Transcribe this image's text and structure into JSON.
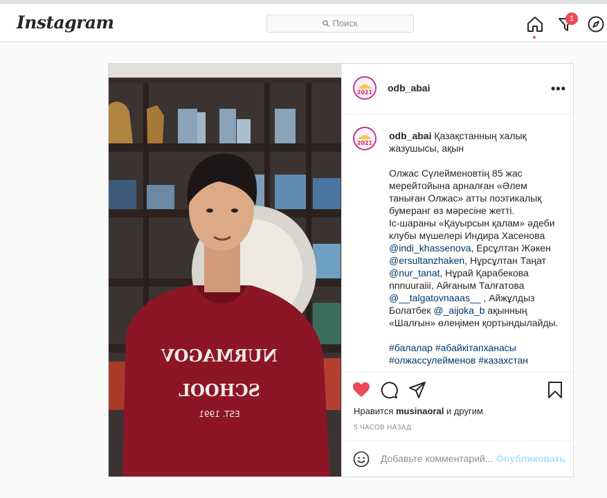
{
  "app": {
    "logo": "Instagram"
  },
  "header": {
    "search_placeholder": "Поиск",
    "notification_count": "1",
    "icons": [
      "home-icon",
      "activity-icon",
      "explore-icon"
    ]
  },
  "post": {
    "username": "odb_abai",
    "avatar_text": "2021",
    "caption": {
      "username": "odb_abai",
      "first": " Қазақстанның халық жазушысы, ақын",
      "body_pre": "Олжас Сүлейменовтің 85 жас мерейтойына арналған «Әлем таныған Олжас» атты поэтикалық бумеранг өз мәресіне жетті.\nІс-шараны «Қауырсын қалам» әдеби клубы мүшелері Индира Хасенова ",
      "m1": "@indi_khassenova",
      "t1": ", Ерсұлтан Жәкен ",
      "m2": "@ersultanzhaken",
      "t2": ", Нұрсұлтан Таңат ",
      "m3": "@nur_tanat",
      "t3": ", Нұрай Қарабекова nnnuuraiii, Айғаным Талғатова ",
      "m4": "@__talgatovnaaas__",
      "t4": " , Айжұлдыз Болатбек ",
      "m5": "@_aijoka_b",
      "t5": " ақынның «Шалғын» өлеңімен қортындылайды.",
      "tags": "#балалар #абайкітапханасы",
      "tags2": "#олжассулейменов #казахстан"
    },
    "hoodie_text_line1": "NURMAGOV",
    "hoodie_text_line2": "SCHOOL",
    "hoodie_text_line3": "EST. 1991",
    "likes_prefix": "Нравится ",
    "likes_user": "musinaoral",
    "likes_suffix": " и другим",
    "time_ago": "5 ЧАСОВ НАЗАД",
    "comment_placeholder": "Добавьте комментарий...",
    "publish_label": "Опубликовать",
    "like_color": "#ed4956"
  }
}
